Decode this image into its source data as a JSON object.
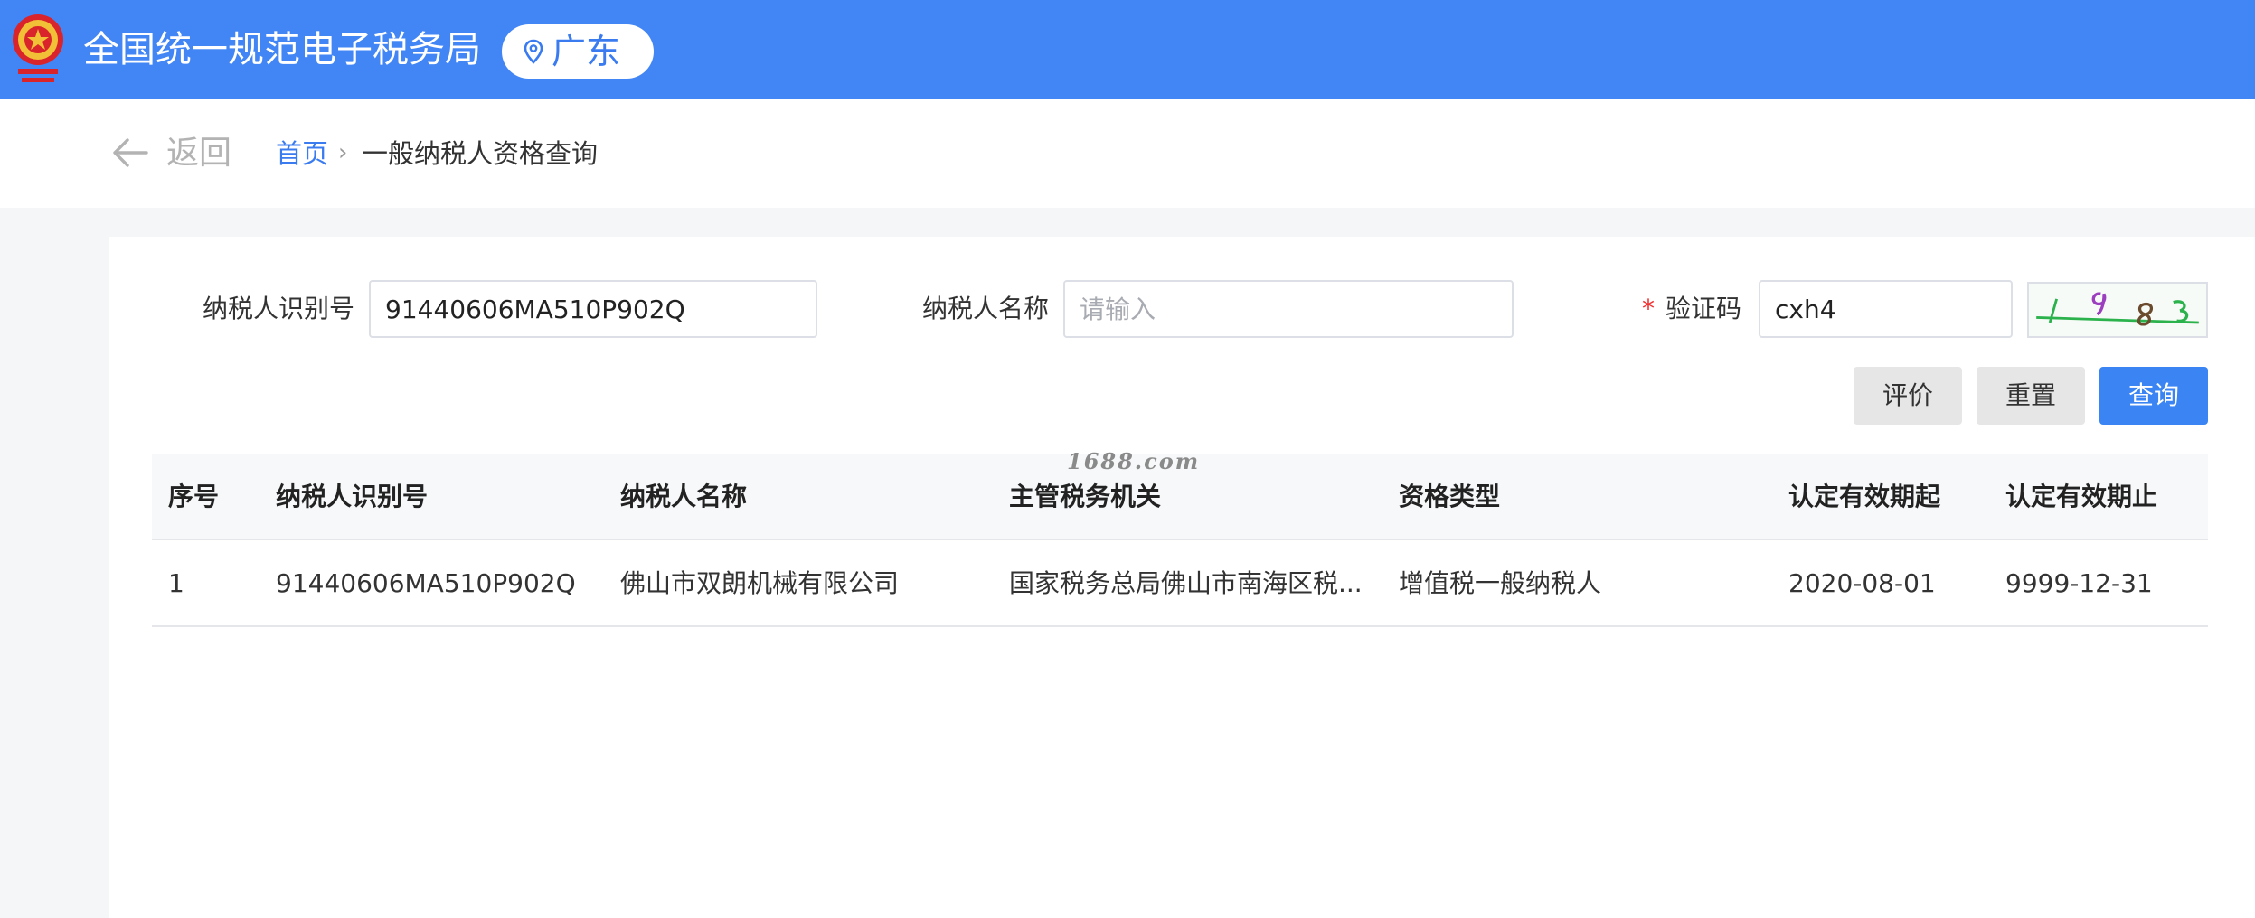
{
  "header": {
    "site_title": "全国统一规范电子税务局",
    "region": "广东",
    "logo_icon": "tax-emblem-icon",
    "region_icon": "location-pin-icon",
    "bg_color": "#4285f4"
  },
  "breadcrumb": {
    "back_label": "返回",
    "home": "首页",
    "current": "一般纳税人资格查询",
    "separator": "›"
  },
  "form": {
    "taxpayer_id_label": "纳税人识别号",
    "taxpayer_id_value": "91440606MA510P902Q",
    "taxpayer_name_label": "纳税人名称",
    "taxpayer_name_placeholder": "请输入",
    "captcha_required_mark": "*",
    "captcha_label": "验证码",
    "captcha_value": "cxh4"
  },
  "buttons": {
    "evaluate": "评价",
    "reset": "重置",
    "query": "查询"
  },
  "watermark": "1688.com",
  "table": {
    "columns": [
      "序号",
      "纳税人识别号",
      "纳税人名称",
      "主管税务机关",
      "资格类型",
      "认定有效期起",
      "认定有效期止"
    ],
    "rows": [
      [
        "1",
        "91440606MA510P902Q",
        "佛山市双朗机械有限公司",
        "国家税务总局佛山市南海区税...",
        "增值税一般纳税人",
        "2020-08-01",
        "9999-12-31"
      ]
    ]
  }
}
